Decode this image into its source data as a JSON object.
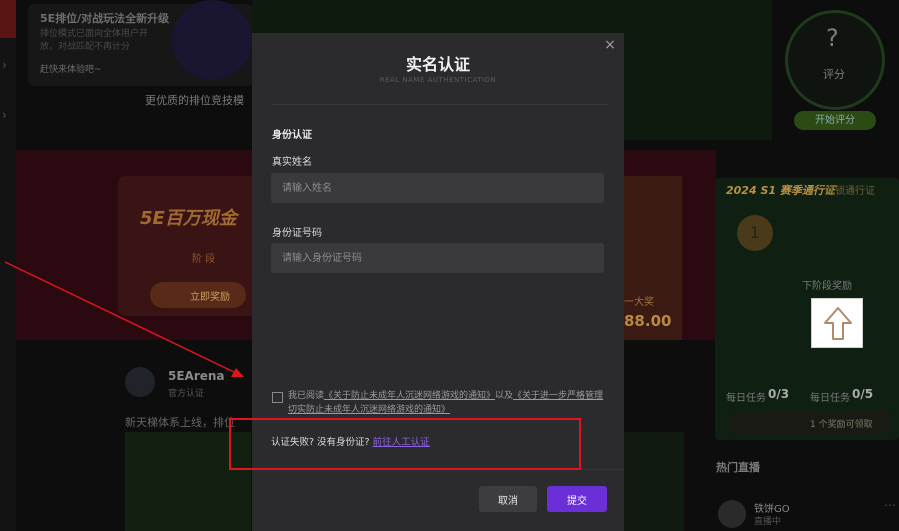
{
  "background": {
    "promo_title": "5E排位/对战玩法全新升级",
    "promo_desc": "排位模式已面向全体用户开放，对战匹配不再计分",
    "promo_link": "赶快来体验吧~",
    "sub_title": "更优质的排位竞技模",
    "score_label": "评分",
    "score_question": "?",
    "score_button": "开始评分",
    "banner_title": "5E百万现金",
    "banner_stage": "阶 段",
    "banner_button": "立即奖励",
    "right_amount_label": "一大奖",
    "right_amount": "88.00",
    "season_title": "2024 S1 赛季通行证",
    "season_subtitle": "解锁通行证",
    "season_level": "1",
    "season_next": "下阶段奖励",
    "daily_label": "每日任务",
    "daily_value": "0/3",
    "weekly_label": "每日任务",
    "weekly_value": "0/5",
    "reward_label": "1 个奖励可领取",
    "feed_name": "5EArena",
    "feed_sub": "官方认证",
    "feed_text": "新天梯体系上线，排位",
    "live_title": "热门直播",
    "live_name": "铁饼GO",
    "live_sub": "直播中",
    "chevron": "›",
    "more": "⋯"
  },
  "modal": {
    "title": "实名认证",
    "subtitle": "REAL NAME AUTHENTICATION",
    "close_icon": "×",
    "section_label": "身份认证",
    "name_label": "真实姓名",
    "name_placeholder": "请输入姓名",
    "name_value": "",
    "id_label": "身份证号码",
    "id_placeholder": "请输入身份证号码",
    "id_value": "",
    "agree_prefix": "我已阅读",
    "agree_link1": "《关于防止未成年人沉迷网络游戏的通知》",
    "agree_mid": "以及",
    "agree_link2": "《关于进一步严格管理切实防止未成年人沉迷网络游戏的通知》",
    "fail_text": "认证失败? 没有身份证?",
    "fail_link": "前往人工认证",
    "cancel_label": "取消",
    "submit_label": "提交",
    "accent_color": "#6a2fd6"
  },
  "annotations": {
    "highlight_color": "#e0141c",
    "up_arrow_icon": "⇧"
  }
}
